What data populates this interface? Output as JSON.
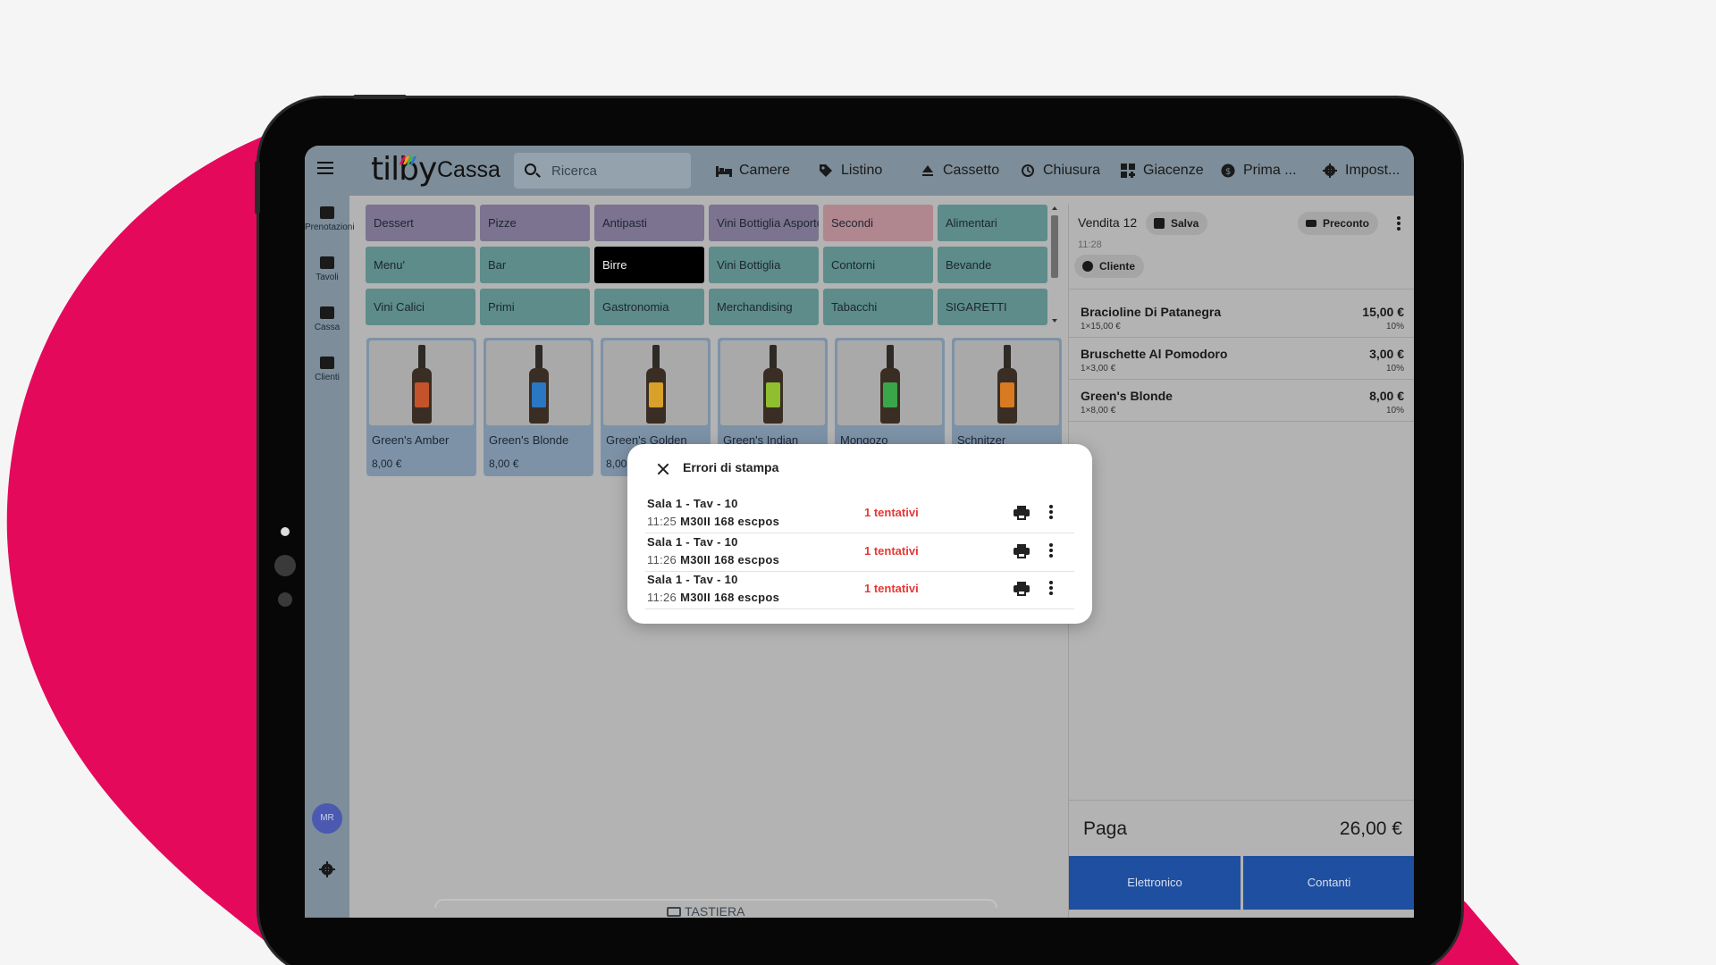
{
  "colors": {
    "brand_pink": "#e5095c",
    "accent_blue": "#1f4fa0",
    "error_red": "#e53935",
    "overlay_gray": "#b3b3b3"
  },
  "topbar": {
    "menu_icon": "hamburger-icon",
    "logo": "tilby",
    "app_title": "Cassa",
    "search_placeholder": "Ricerca",
    "nav": [
      {
        "label": "Camere",
        "icon": "bed-icon"
      },
      {
        "label": "Listino",
        "icon": "tag-icon"
      },
      {
        "label": "Cassetto",
        "icon": "eject-icon"
      },
      {
        "label": "Chiusura",
        "icon": "history-icon"
      },
      {
        "label": "Giacenze",
        "icon": "grid-plus-icon"
      },
      {
        "label": "Prima ...",
        "icon": "currency-icon"
      },
      {
        "label": "Impost...",
        "icon": "gear-icon"
      }
    ]
  },
  "rail": {
    "items": [
      {
        "label": "Prenotazioni",
        "icon": "calendar-icon"
      },
      {
        "label": "Tavoli",
        "icon": "tables-icon"
      },
      {
        "label": "Cassa",
        "icon": "keyboard-icon"
      },
      {
        "label": "Clienti",
        "icon": "people-icon"
      }
    ],
    "avatar": "MR"
  },
  "categories": [
    {
      "label": "Dessert",
      "color": "#7b7390"
    },
    {
      "label": "Pizze",
      "color": "#7b7390"
    },
    {
      "label": "Antipasti",
      "color": "#7b7390"
    },
    {
      "label": "Vini Bottiglia Asporto",
      "color": "#7b7390"
    },
    {
      "label": "Secondi",
      "color": "#b0868f"
    },
    {
      "label": "Alimentari",
      "color": "#5d8c8a"
    },
    {
      "label": "Menu'",
      "color": "#5d8c8a"
    },
    {
      "label": "Bar",
      "color": "#5d8c8a"
    },
    {
      "label": "Birre",
      "color": "#000000"
    },
    {
      "label": "Vini Bottiglia",
      "color": "#5d8c8a"
    },
    {
      "label": "Contorni",
      "color": "#5d8c8a"
    },
    {
      "label": "Bevande",
      "color": "#5d8c8a"
    },
    {
      "label": "Vini Calici",
      "color": "#5d8c8a"
    },
    {
      "label": "Primi",
      "color": "#5d8c8a"
    },
    {
      "label": "Gastronomia",
      "color": "#5d8c8a"
    },
    {
      "label": "Merchandising",
      "color": "#5d8c8a"
    },
    {
      "label": "Tabacchi",
      "color": "#5d8c8a"
    },
    {
      "label": "SIGARETTI",
      "color": "#5d8c8a"
    }
  ],
  "products": [
    {
      "name": "Green's Amber",
      "price": "8,00 €",
      "label_color": "#c4532c"
    },
    {
      "name": "Green's Blonde",
      "price": "8,00 €",
      "label_color": "#2a78c4"
    },
    {
      "name": "Green's Golden",
      "price": "8,00",
      "label_color": "#d9a12a"
    },
    {
      "name": "Green's Indian",
      "price": "",
      "label_color": "#8fbf2e"
    },
    {
      "name": "Mongozo",
      "price": "",
      "label_color": "#3aa64a"
    },
    {
      "name": "Schnitzer",
      "price": "",
      "label_color": "#d77a22"
    }
  ],
  "keyboard_hint": "TASTIERA",
  "sale": {
    "title": "Vendita 12",
    "save_label": "Salva",
    "time": "11:28",
    "customer_label": "Cliente",
    "receipt_label": "Preconto",
    "items": [
      {
        "name": "Bracioline Di Patanegra",
        "qty": "1×15,00 €",
        "price": "15,00 €",
        "vat": "10%"
      },
      {
        "name": "Bruschette Al Pomodoro",
        "qty": "1×3,00 €",
        "price": "3,00 €",
        "vat": "10%"
      },
      {
        "name": "Green's Blonde",
        "qty": "1×8,00 €",
        "price": "8,00 €",
        "vat": "10%"
      }
    ],
    "pay_label": "Paga",
    "total": "26,00 €",
    "pay_electronic": "Elettronico",
    "pay_cash": "Contanti"
  },
  "modal": {
    "title": "Errori di stampa",
    "rows": [
      {
        "location": "Sala 1 - Tav - 10",
        "time": "11:25",
        "printer": "M30II 168 escpos",
        "attempts": "1 tentativi"
      },
      {
        "location": "Sala 1 - Tav - 10",
        "time": "11:26",
        "printer": "M30II 168 escpos",
        "attempts": "1 tentativi"
      },
      {
        "location": "Sala 1 - Tav - 10",
        "time": "11:26",
        "printer": "M30II 168 escpos",
        "attempts": "1 tentativi"
      }
    ]
  }
}
